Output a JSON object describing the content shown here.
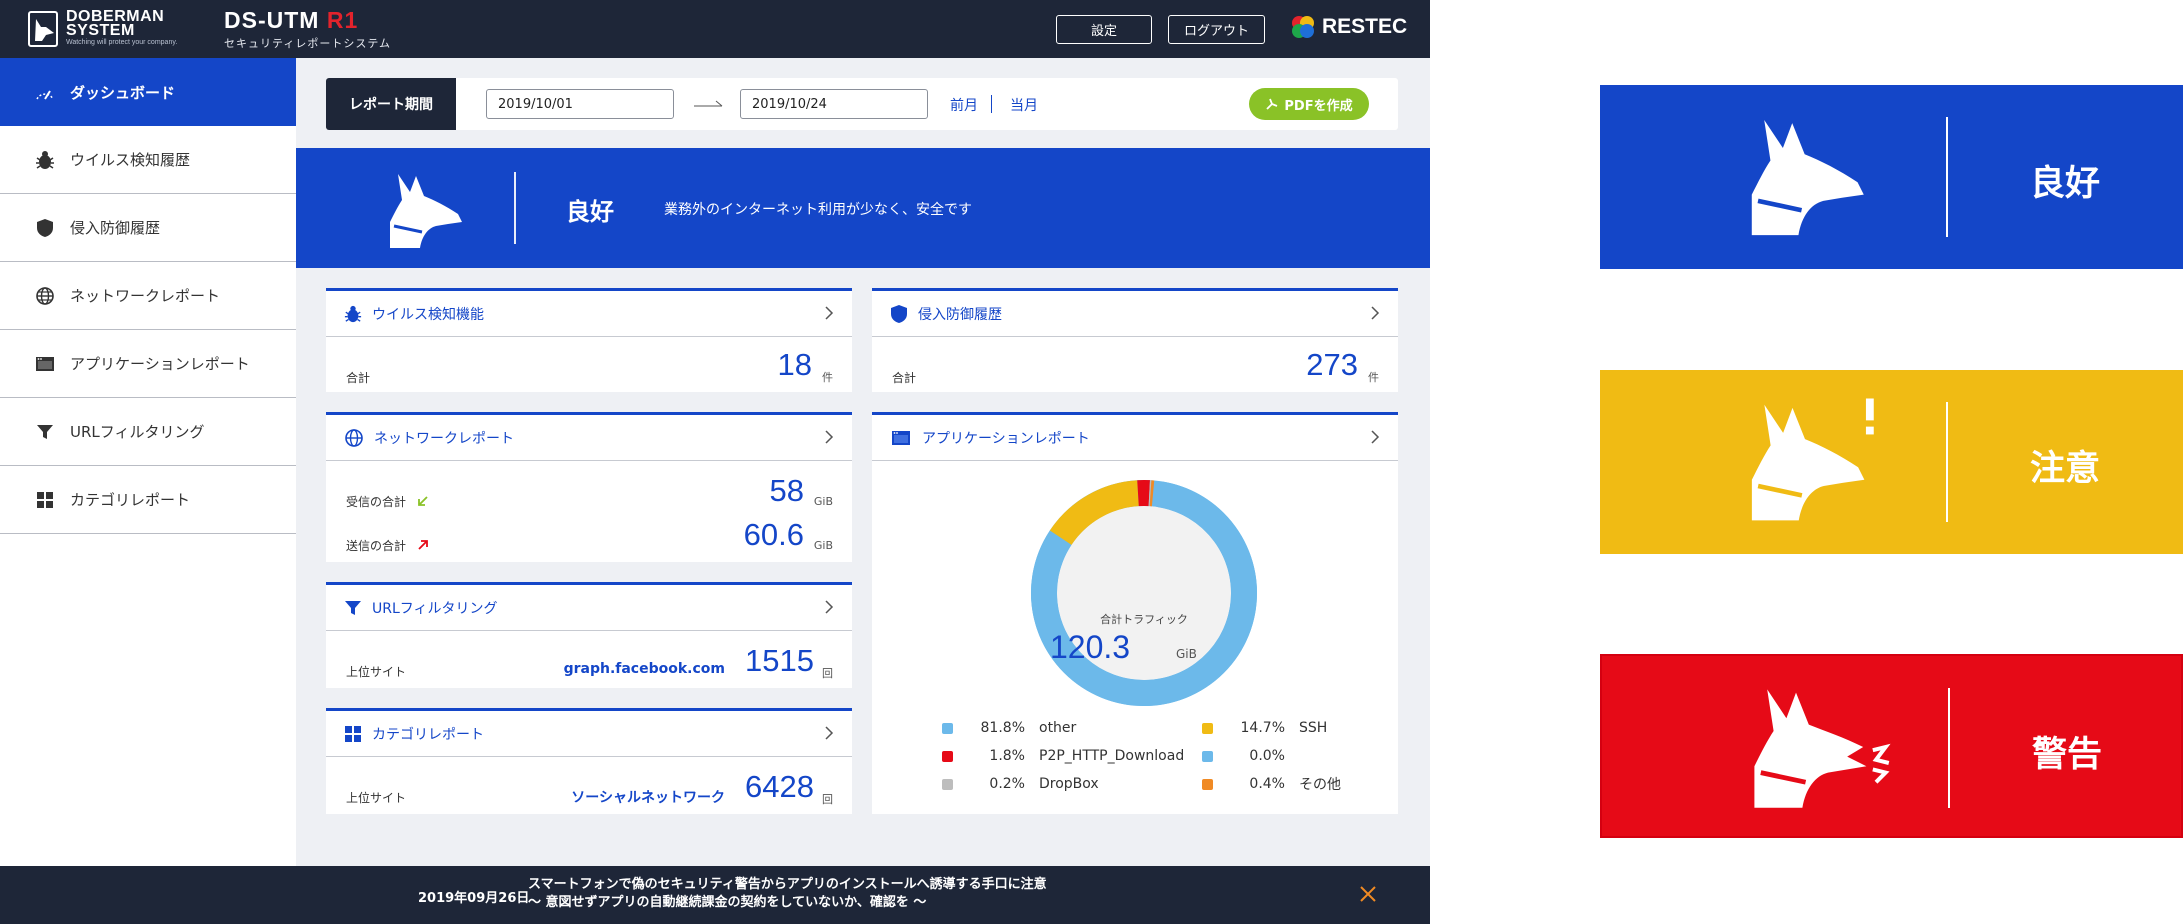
{
  "header": {
    "brand_name_line1": "DOBERMAN",
    "brand_name_line2": "SYSTEM",
    "brand_tagline": "Watching will protect your company.",
    "product_name": "DS-UTM",
    "product_model": "R1",
    "product_sub": "セキュリティレポートシステム",
    "settings_label": "設定",
    "logout_label": "ログアウト",
    "vendor": "RESTEC"
  },
  "sidebar": {
    "items": [
      {
        "label": "ダッシュボード",
        "icon": "dashboard-icon",
        "active": true
      },
      {
        "label": "ウイルス検知履歴",
        "icon": "bug-icon"
      },
      {
        "label": "侵入防御履歴",
        "icon": "shield-icon"
      },
      {
        "label": "ネットワークレポート",
        "icon": "globe-icon"
      },
      {
        "label": "アプリケーションレポート",
        "icon": "window-icon"
      },
      {
        "label": "URLフィルタリング",
        "icon": "filter-icon"
      },
      {
        "label": "カテゴリレポート",
        "icon": "grid-icon"
      }
    ]
  },
  "period": {
    "label": "レポート期間",
    "from": "2019/10/01",
    "to": "2019/10/24",
    "prev_month": "前月",
    "this_month": "当月",
    "pdf_label": "PDFを作成"
  },
  "status": {
    "label": "良好",
    "message": "業務外のインターネット利用が少なく、安全です",
    "color": "#1446c8"
  },
  "cards": {
    "virus": {
      "title": "ウイルス検知機能",
      "total_label": "合計",
      "total": "18",
      "unit": "件"
    },
    "intrusion": {
      "title": "侵入防御履歴",
      "total_label": "合計",
      "total": "273",
      "unit": "件"
    },
    "network": {
      "title": "ネットワークレポート",
      "recv_label": "受信の合計",
      "recv": "58",
      "recv_unit": "GiB",
      "send_label": "送信の合計",
      "send": "60.6",
      "send_unit": "GiB"
    },
    "url": {
      "title": "URLフィルタリング",
      "top_label": "上位サイト",
      "top_site": "graph.facebook.com",
      "count": "1515",
      "unit": "回"
    },
    "category": {
      "title": "カテゴリレポート",
      "top_label": "上位サイト",
      "top_site": "ソーシャルネットワーク",
      "count": "6428",
      "unit": "回"
    },
    "app": {
      "title": "アプリケーションレポート",
      "center_label": "合計トラフィック",
      "total": "120.3",
      "unit": "GiB"
    }
  },
  "chart_data": {
    "type": "pie",
    "title": "合計トラフィック",
    "total": 120.3,
    "unit": "GiB",
    "slices": [
      {
        "name": "other",
        "pct": 81.8,
        "color": "#6cb9ea"
      },
      {
        "name": "SSH",
        "pct": 14.7,
        "color": "#f0bb14"
      },
      {
        "name": "P2P_HTTP_Download",
        "pct": 1.8,
        "color": "#e60a17"
      },
      {
        "name": "DropBox",
        "pct": 0.2,
        "color": "#bdbdbd"
      },
      {
        "name": "その他",
        "pct": 0.4,
        "color": "#f08a24"
      },
      {
        "name": "",
        "pct": 0.0,
        "color": "#6cb9ea"
      }
    ],
    "legend": [
      {
        "pct": "81.8%",
        "name": "other",
        "color": "#6cb9ea"
      },
      {
        "pct": "14.7%",
        "name": "SSH",
        "color": "#f0bb14"
      },
      {
        "pct": "1.8%",
        "name": "P2P_HTTP_Download",
        "color": "#e60a17"
      },
      {
        "pct": "0.0%",
        "name": "",
        "color": "#6cb9ea"
      },
      {
        "pct": "0.2%",
        "name": "DropBox",
        "color": "#bdbdbd"
      },
      {
        "pct": "0.4%",
        "name": "その他",
        "color": "#f08a24"
      }
    ],
    "legend_placement": "bottom"
  },
  "footer": {
    "date": "2019年09月26日",
    "line1": "スマートフォンで偽のセキュリティ警告からアプリのインストールへ誘導する手口に注意",
    "line2": "〜 意図せずアプリの自動継続課金の契約をしていないか、確認を 〜"
  },
  "status_legend": [
    {
      "label": "良好",
      "color": "#1446c8"
    },
    {
      "label": "注意",
      "color": "#f0bb14"
    },
    {
      "label": "警告",
      "color": "#e60a17"
    }
  ]
}
